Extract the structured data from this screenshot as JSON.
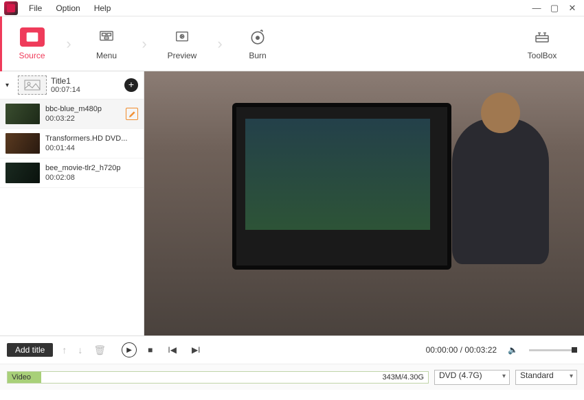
{
  "menu": {
    "file": "File",
    "option": "Option",
    "help": "Help"
  },
  "toolbar": {
    "source": "Source",
    "menu": "Menu",
    "preview": "Preview",
    "burn": "Burn",
    "toolbox": "ToolBox"
  },
  "title": {
    "name": "Title1",
    "duration": "00:07:14"
  },
  "clips": [
    {
      "name": "bbc-blue_m480p",
      "duration": "00:03:22"
    },
    {
      "name": "Transformers.HD DVD...",
      "duration": "00:01:44"
    },
    {
      "name": "bee_movie-tlr2_h720p",
      "duration": "00:02:08"
    }
  ],
  "controls": {
    "add_title": "Add title",
    "time_current": "00:00:00",
    "time_total": "00:03:22"
  },
  "bottom": {
    "track_label": "Video",
    "size": "343M/4.30G",
    "disc_type": "DVD (4.7G)",
    "quality": "Standard"
  }
}
